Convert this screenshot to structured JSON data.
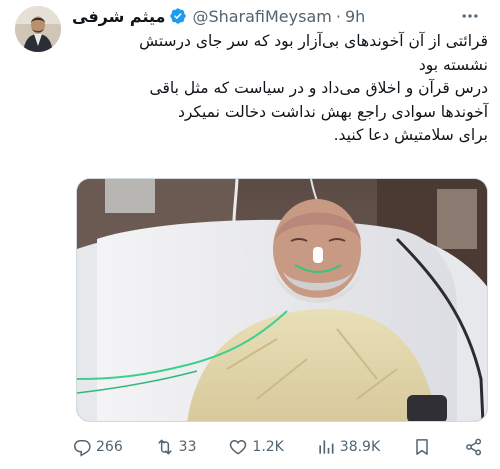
{
  "author": {
    "display_name": "میثم شرفی",
    "handle": "@SharafiMeysam",
    "separator": "·",
    "time": "9h"
  },
  "tweet": {
    "lines": [
      "قرائتی از آن آخوندهای بی‌آزار بود که سر جای درستش",
      "نشسته بود",
      "درس قرآن و اخلاق می‌داد و در سیاست که مثل باقی",
      "آخوندها سوادی راجع بهش نداشت دخالت نمیکرد",
      "برای سلامتیش دعا کنید."
    ]
  },
  "actions": {
    "replies": "266",
    "retweets": "33",
    "likes": "1.2K",
    "views": "38.9K"
  },
  "icons": {
    "verified": "verified-badge-icon",
    "more": "more-options-icon",
    "reply": "reply-icon",
    "retweet": "retweet-icon",
    "like": "heart-icon",
    "views": "analytics-icon",
    "bookmark": "bookmark-icon",
    "share": "share-icon"
  },
  "colors": {
    "verified": "#1d9bf0",
    "muted": "#536471",
    "text": "#0f1419"
  }
}
